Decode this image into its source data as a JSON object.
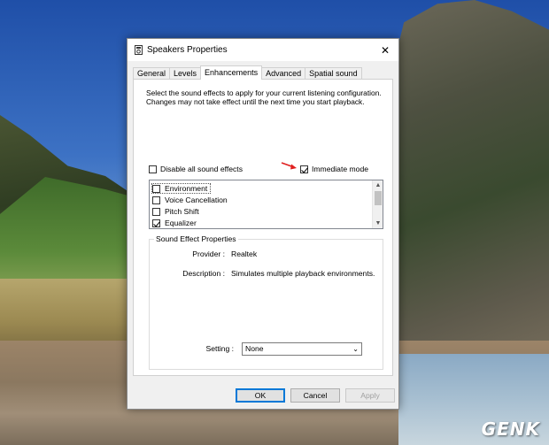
{
  "window": {
    "title": "Speakers Properties",
    "close_glyph": "✕"
  },
  "tabs": [
    {
      "label": "General"
    },
    {
      "label": "Levels"
    },
    {
      "label": "Enhancements",
      "active": true
    },
    {
      "label": "Advanced"
    },
    {
      "label": "Spatial sound"
    }
  ],
  "enhancements": {
    "description": "Select the sound effects to apply for your current listening configuration. Changes may not take effect until the next time you start playback.",
    "disable_all_label": "Disable all sound effects",
    "disable_all_checked": false,
    "immediate_mode_label": "Immediate mode",
    "immediate_mode_checked": true,
    "effects": [
      {
        "label": "Environment",
        "checked": false,
        "selected": true
      },
      {
        "label": "Voice Cancellation",
        "checked": false
      },
      {
        "label": "Pitch Shift",
        "checked": false
      },
      {
        "label": "Equalizer",
        "checked": true
      }
    ],
    "group_title": "Sound Effect Properties",
    "provider_label": "Provider :",
    "provider_value": "Realtek",
    "description_label": "Description :",
    "description_value": "Simulates multiple playback environments.",
    "setting_label": "Setting :",
    "setting_value": "None"
  },
  "buttons": {
    "ok": "OK",
    "cancel": "Cancel",
    "apply": "Apply"
  },
  "colors": {
    "annotation_arrow": "#e0201f",
    "focus_blue": "#0078d7"
  },
  "watermark": "GENK"
}
